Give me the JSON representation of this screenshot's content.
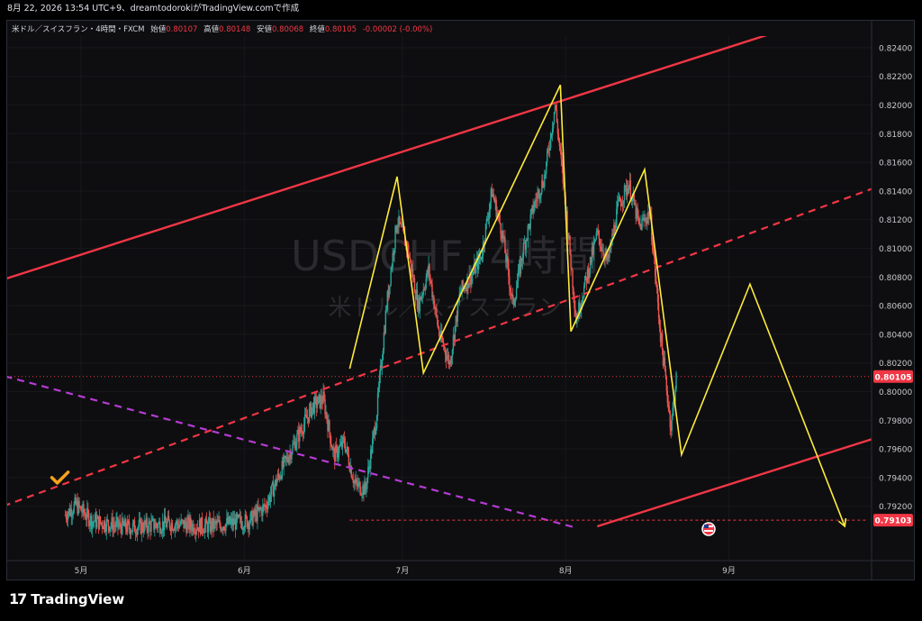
{
  "header": {
    "caption": "8月 22, 2026 13:54 UTC+9、dreamtodorokiがTradingView.comで作成"
  },
  "legend": {
    "symbol": "米ドル／スイスフラン・4時間・FXCM",
    "open_label": "始値",
    "open": "0.80107",
    "high_label": "高値",
    "high": "0.80148",
    "low_label": "安値",
    "low": "0.80068",
    "close_label": "終値",
    "close": "0.80105",
    "change": "-0.00002 (-0.00%)"
  },
  "watermark": {
    "line1": "USDCHF, 4時間",
    "line2": "米ドル／スイスフラン"
  },
  "footer": {
    "brand": "TradingView"
  },
  "colors": {
    "bull": "#26a69a",
    "bear": "#ef5350",
    "channel": "#f23645",
    "trend": "#b63bd4",
    "zigzag": "#ffeb3b",
    "check": "#f7a21b"
  },
  "chart_data": {
    "type": "candlestick",
    "y_ticks": [
      "0.82400",
      "0.82200",
      "0.82000",
      "0.81800",
      "0.81600",
      "0.81400",
      "0.81200",
      "0.81000",
      "0.80800",
      "0.80600",
      "0.80400",
      "0.80200",
      "0.80000",
      "0.79800",
      "0.79600",
      "0.79400",
      "0.79200"
    ],
    "x_ticks": [
      {
        "label": "5月",
        "date": "2026-05-01"
      },
      {
        "label": "6月",
        "date": "2026-06-01"
      },
      {
        "label": "7月",
        "date": "2026-07-01"
      },
      {
        "label": "8月",
        "date": "2026-08-01"
      },
      {
        "label": "9月",
        "date": "2026-09-01"
      }
    ],
    "ylim": [
      0.7905,
      0.825
    ],
    "price_labels": [
      {
        "value": "0.80105",
        "price": 0.80105
      },
      {
        "value": "0.79103",
        "price": 0.79103
      }
    ],
    "close_series": [
      [
        "2026-04-28",
        0.7914
      ],
      [
        "2026-04-30",
        0.7921
      ],
      [
        "2026-05-03",
        0.791
      ],
      [
        "2026-05-10",
        0.7905
      ],
      [
        "2026-05-18",
        0.7908
      ],
      [
        "2026-05-25",
        0.7906
      ],
      [
        "2026-06-02",
        0.791
      ],
      [
        "2026-06-05",
        0.792
      ],
      [
        "2026-06-08",
        0.7945
      ],
      [
        "2026-06-10",
        0.796
      ],
      [
        "2026-06-12",
        0.7975
      ],
      [
        "2026-06-14",
        0.799
      ],
      [
        "2026-06-16",
        0.7995
      ],
      [
        "2026-06-18",
        0.7955
      ],
      [
        "2026-06-20",
        0.7965
      ],
      [
        "2026-06-22",
        0.7935
      ],
      [
        "2026-06-24",
        0.7932
      ],
      [
        "2026-06-26",
        0.798
      ],
      [
        "2026-06-28",
        0.806
      ],
      [
        "2026-06-30",
        0.812
      ],
      [
        "2026-07-02",
        0.81
      ],
      [
        "2026-07-04",
        0.806
      ],
      [
        "2026-07-06",
        0.8085
      ],
      [
        "2026-07-08",
        0.804
      ],
      [
        "2026-07-10",
        0.802
      ],
      [
        "2026-07-12",
        0.807
      ],
      [
        "2026-07-14",
        0.808
      ],
      [
        "2026-07-16",
        0.8095
      ],
      [
        "2026-07-18",
        0.814
      ],
      [
        "2026-07-20",
        0.811
      ],
      [
        "2026-07-22",
        0.806
      ],
      [
        "2026-07-24",
        0.81
      ],
      [
        "2026-07-26",
        0.813
      ],
      [
        "2026-07-28",
        0.815
      ],
      [
        "2026-07-30",
        0.82
      ],
      [
        "2026-08-01",
        0.813
      ],
      [
        "2026-08-03",
        0.805
      ],
      [
        "2026-08-05",
        0.808
      ],
      [
        "2026-08-07",
        0.811
      ],
      [
        "2026-08-09",
        0.809
      ],
      [
        "2026-08-11",
        0.813
      ],
      [
        "2026-08-13",
        0.8145
      ],
      [
        "2026-08-15",
        0.8115
      ],
      [
        "2026-08-17",
        0.8125
      ],
      [
        "2026-08-19",
        0.804
      ],
      [
        "2026-08-21",
        0.7975
      ],
      [
        "2026-08-22",
        0.801
      ]
    ],
    "drawings": {
      "channel_upper": [
        [
          "2026-04-05",
          0.8065
        ],
        [
          "2026-09-16",
          0.8258
        ]
      ],
      "channel_lower": [
        [
          "2026-08-07",
          0.7906
        ],
        [
          "2026-09-30",
          0.7969
        ]
      ],
      "channel_mid_dashed": [
        [
          "2026-04-05",
          0.7905
        ],
        [
          "2026-09-30",
          0.8144
        ]
      ],
      "trendline_dashed": [
        [
          "2026-04-05",
          0.8022
        ],
        [
          "2026-08-03",
          0.7905
        ]
      ],
      "support_dotted": [
        [
          "2026-06-21",
          0.79103
        ],
        [
          "2026-09-27",
          0.79103
        ]
      ],
      "close_line": 0.80105,
      "zigzag": [
        [
          "2026-06-21",
          0.8016
        ],
        [
          "2026-06-30",
          0.815
        ],
        [
          "2026-07-05",
          0.8013
        ],
        [
          "2026-07-31",
          0.8214
        ],
        [
          "2026-08-02",
          0.8042
        ],
        [
          "2026-08-16",
          0.8155
        ],
        [
          "2026-08-23",
          0.7956
        ],
        [
          "2026-09-05",
          0.8075
        ],
        [
          "2026-09-23",
          0.7906
        ]
      ],
      "checkmark": [
        "2026-04-27",
        0.794
      ]
    }
  }
}
